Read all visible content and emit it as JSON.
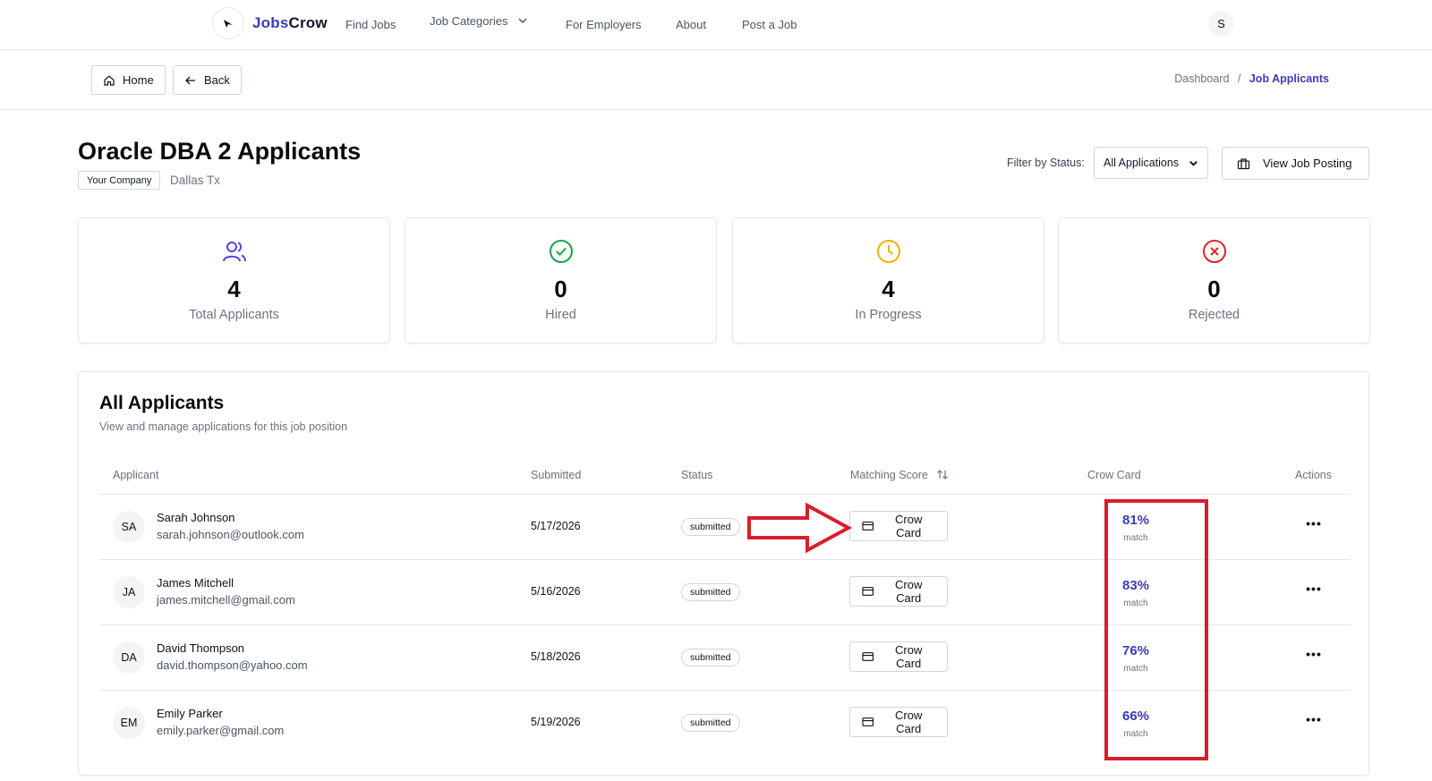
{
  "nav": {
    "brand_part1": "Jobs",
    "brand_part2": "Crow",
    "links": [
      "Find Jobs",
      "Job Categories",
      "For Employers",
      "About",
      "Post a Job"
    ],
    "user_initial": "S"
  },
  "subbar": {
    "home_label": "Home",
    "back_label": "Back",
    "breadcrumb": [
      "Dashboard",
      "/",
      "Job Applicants"
    ]
  },
  "header": {
    "title": "Oracle DBA 2 Applicants",
    "company": "Your Company",
    "location": "Dallas Tx",
    "filter_label": "Filter by Status:",
    "filter_value": "All Applications",
    "view_posting_label": "View Job Posting"
  },
  "stats": [
    {
      "value": "4",
      "label": "Total Applicants",
      "icon": "users-icon",
      "color": "#4f46e5"
    },
    {
      "value": "0",
      "label": "Hired",
      "icon": "check-circle-icon",
      "color": "#16a34a"
    },
    {
      "value": "4",
      "label": "In Progress",
      "icon": "clock-icon",
      "color": "#eab308"
    },
    {
      "value": "0",
      "label": "Rejected",
      "icon": "x-circle-icon",
      "color": "#dc2626"
    }
  ],
  "applicants_panel": {
    "title": "All Applicants",
    "subtitle": "View and manage applications for this job position",
    "columns": [
      "Applicant",
      "Submitted",
      "Status",
      "Matching Score",
      "Crow Card",
      "Actions"
    ],
    "rows": [
      {
        "initials": "SA",
        "name": "Sarah Johnson",
        "email": "sarah.johnson@outlook.com",
        "submitted": "5/17/2026",
        "status": "submitted",
        "crow_card_label": "Crow Card",
        "score": "81%",
        "score_sub": "match",
        "actions": "•••"
      },
      {
        "initials": "JA",
        "name": "James Mitchell",
        "email": "james.mitchell@gmail.com",
        "submitted": "5/16/2026",
        "status": "submitted",
        "crow_card_label": "Crow Card",
        "score": "83%",
        "score_sub": "match",
        "actions": "•••"
      },
      {
        "initials": "DA",
        "name": "David Thompson",
        "email": "david.thompson@yahoo.com",
        "submitted": "5/18/2026",
        "status": "submitted",
        "crow_card_label": "Crow Card",
        "score": "76%",
        "score_sub": "match",
        "actions": "•••"
      },
      {
        "initials": "EM",
        "name": "Emily Parker",
        "email": "emily.parker@gmail.com",
        "submitted": "5/19/2026",
        "status": "submitted",
        "crow_card_label": "Crow Card",
        "score": "66%",
        "score_sub": "match",
        "actions": "•••"
      }
    ]
  },
  "colors": {
    "accent": "#3b3bb5",
    "annotation_red": "#d81e2c",
    "border": "#e5e7eb"
  }
}
